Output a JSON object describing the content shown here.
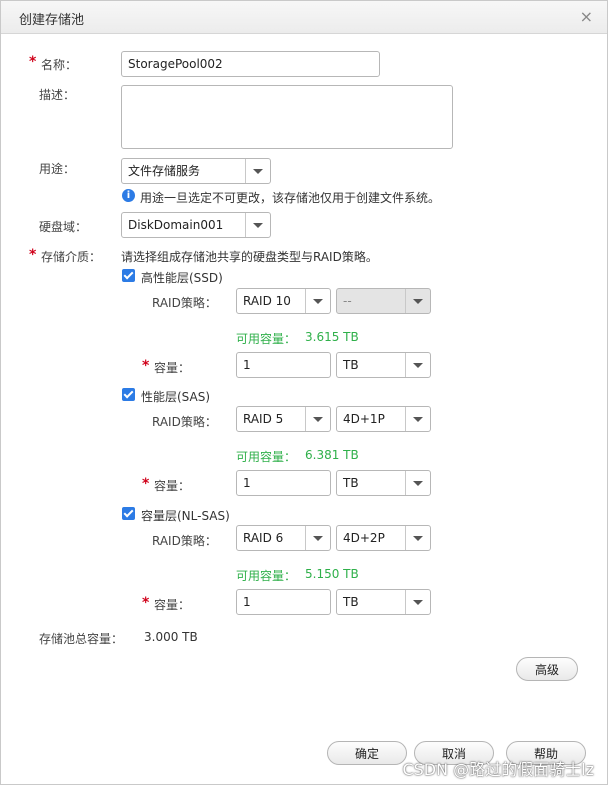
{
  "dialog": {
    "title": "创建存储池",
    "close_symbol": "×"
  },
  "form": {
    "name_label": "名称：",
    "name_value": "StoragePool002",
    "desc_label": "描述：",
    "desc_value": "",
    "usage_label": "用途：",
    "usage_value": "文件存储服务",
    "usage_note": "用途一旦选定不可更改，该存储池仅用于创建文件系统。",
    "disk_domain_label": "硬盘域：",
    "disk_domain_value": "DiskDomain001",
    "medium_label": "存储介质：",
    "medium_hint": "请选择组成存储池共享的硬盘类型与RAID策略。",
    "raid_label": "RAID策略：",
    "avail_label": "可用容量：",
    "capacity_label": "容量：",
    "tiers": [
      {
        "name": "高性能层(SSD)",
        "raid": "RAID 10",
        "layout": "--",
        "available": "3.615 TB",
        "capacity": "1",
        "unit": "TB",
        "checked": true
      },
      {
        "name": "性能层(SAS)",
        "raid": "RAID 5",
        "layout": "4D+1P",
        "available": "6.381 TB",
        "capacity": "1",
        "unit": "TB",
        "checked": true
      },
      {
        "name": "容量层(NL-SAS)",
        "raid": "RAID 6",
        "layout": "4D+2P",
        "available": "5.150 TB",
        "capacity": "1",
        "unit": "TB",
        "checked": true
      }
    ],
    "total_label": "存储池总容量：",
    "total_value": "3.000 TB"
  },
  "buttons": {
    "advanced": "高级",
    "ok": "确定",
    "cancel": "取消",
    "help": "帮助"
  },
  "watermark": "CSDN @路过的假面骑士lz",
  "colors": {
    "accent": "#2c7be5",
    "required": "#d0021b",
    "available": "#2fb04a"
  }
}
